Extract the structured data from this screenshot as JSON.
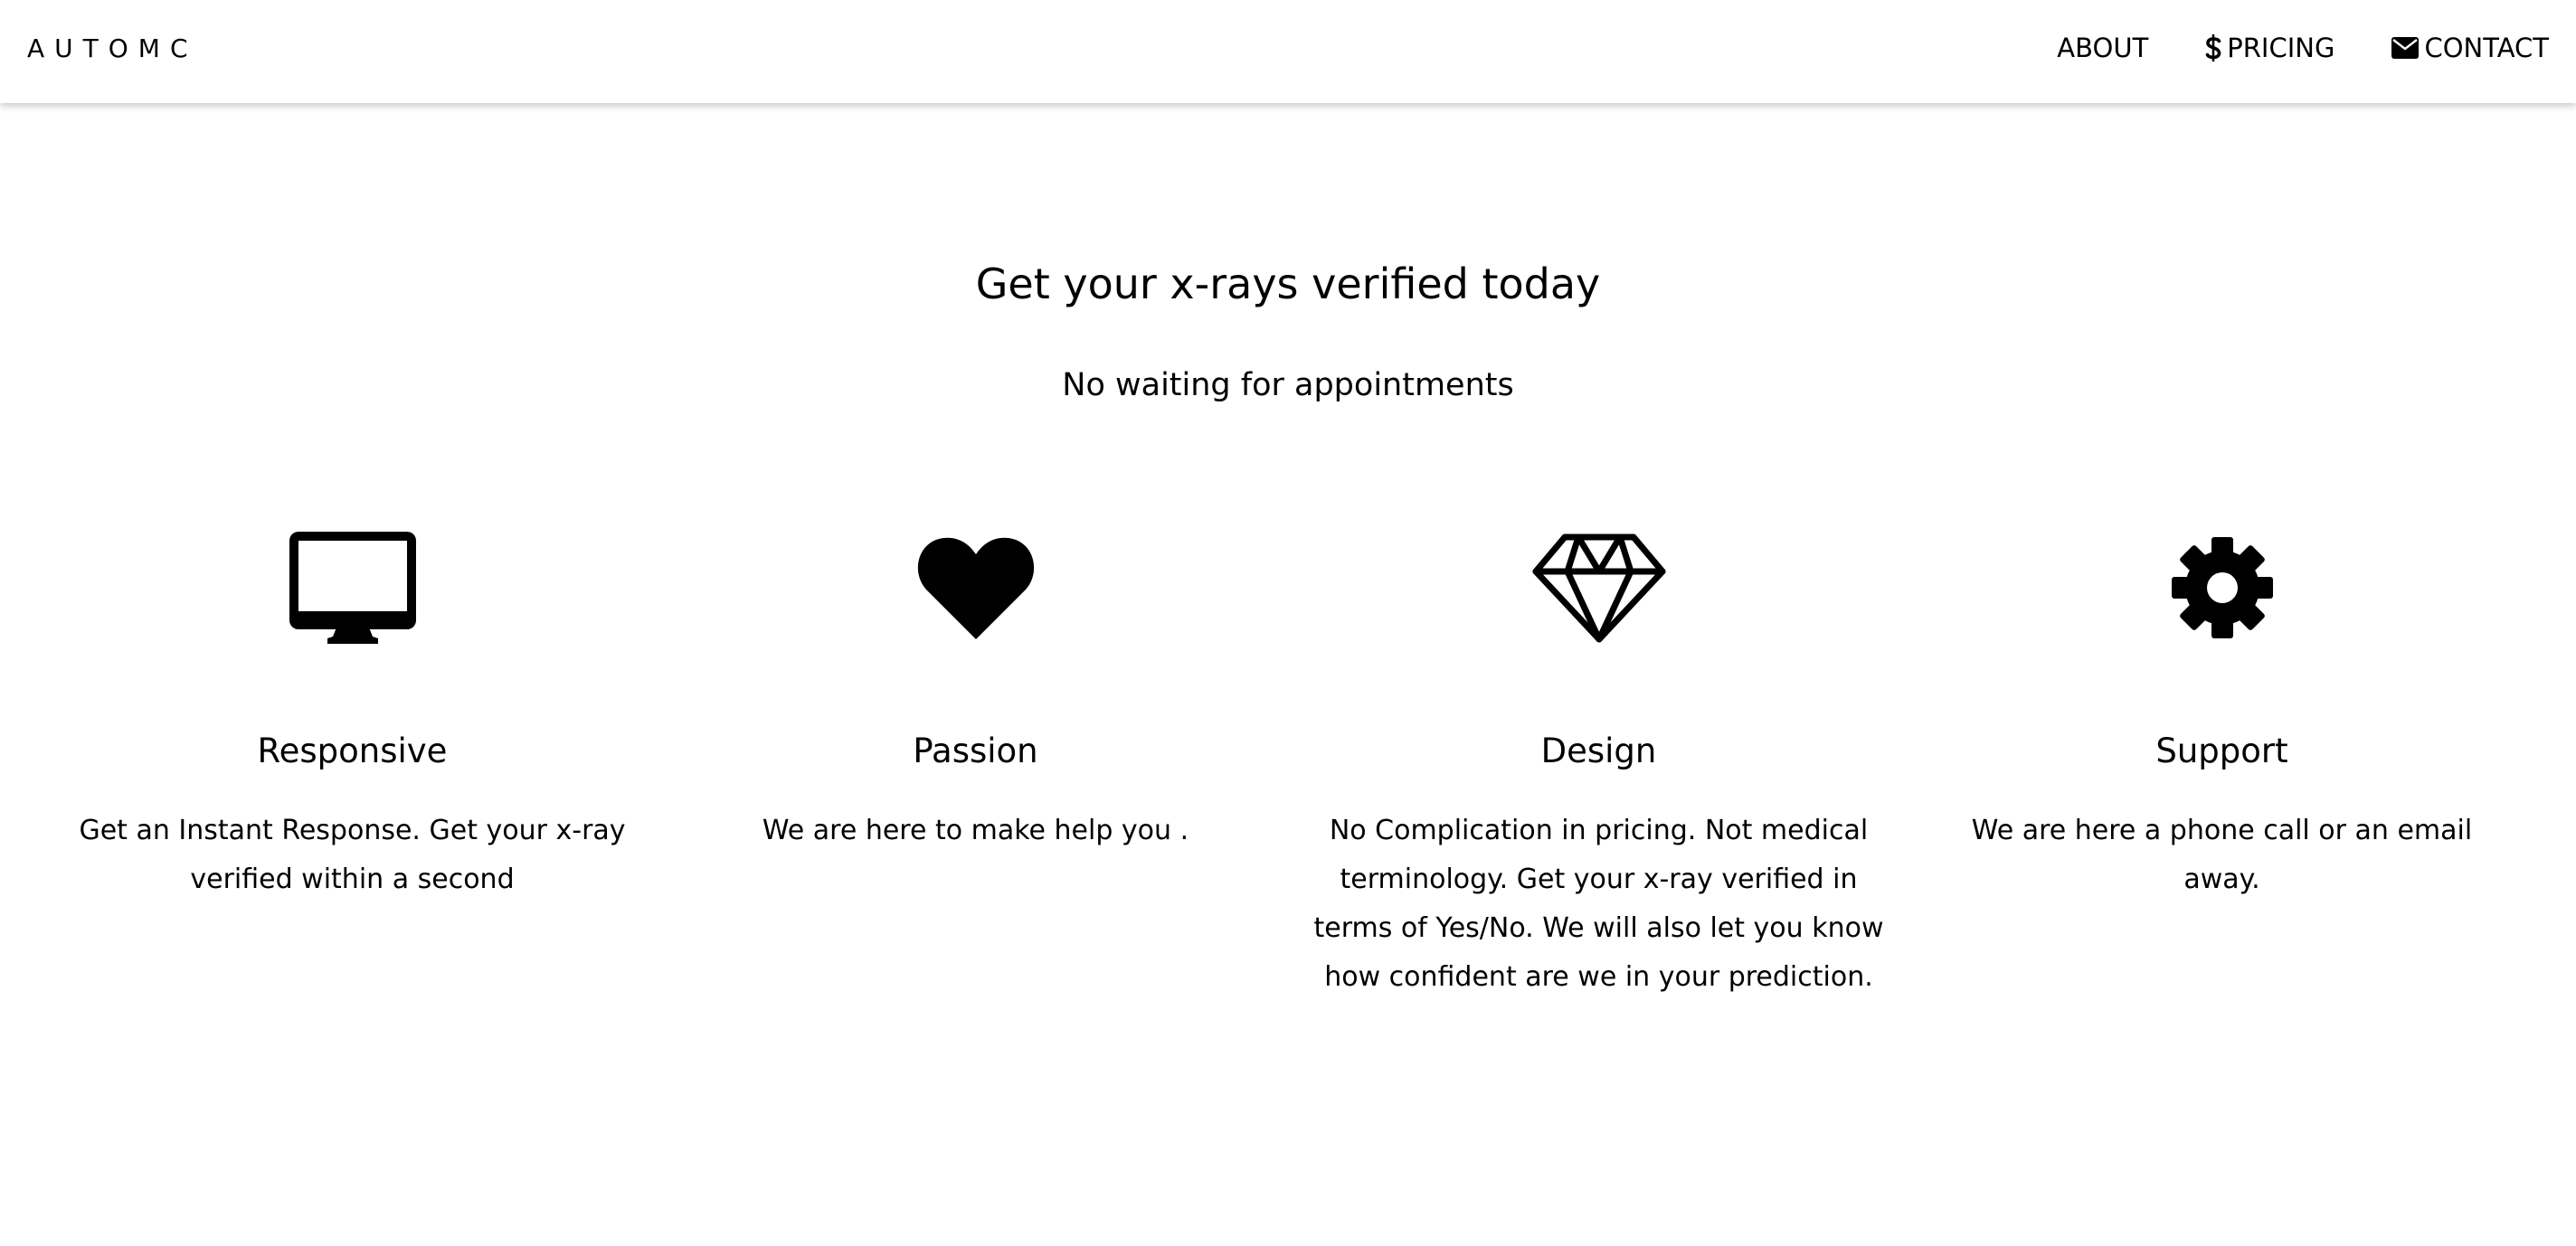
{
  "header": {
    "logo": "AUTOMC",
    "nav": [
      {
        "label": "ABOUT",
        "icon": ""
      },
      {
        "label": "PRICING",
        "icon": "dollar-icon"
      },
      {
        "label": "CONTACT",
        "icon": "envelope-icon"
      }
    ]
  },
  "hero": {
    "title": "Get your x-rays verified today",
    "subtitle": "No waiting for appointments"
  },
  "features": [
    {
      "icon": "desktop-icon",
      "title": "Responsive",
      "text": "Get an Instant Response. Get your x-ray verified within a second"
    },
    {
      "icon": "heart-icon",
      "title": "Passion",
      "text": "We are here to make help you ."
    },
    {
      "icon": "diamond-icon",
      "title": "Design",
      "text": "No Complication in pricing. Not medical terminology. Get your x-ray verified in terms of Yes/No. We will also let you know how confident are we in your prediction."
    },
    {
      "icon": "gear-icon",
      "title": "Support",
      "text": "We are here a phone call or an email away."
    }
  ],
  "colors": {
    "background": "#ffffff",
    "text": "#000000"
  }
}
